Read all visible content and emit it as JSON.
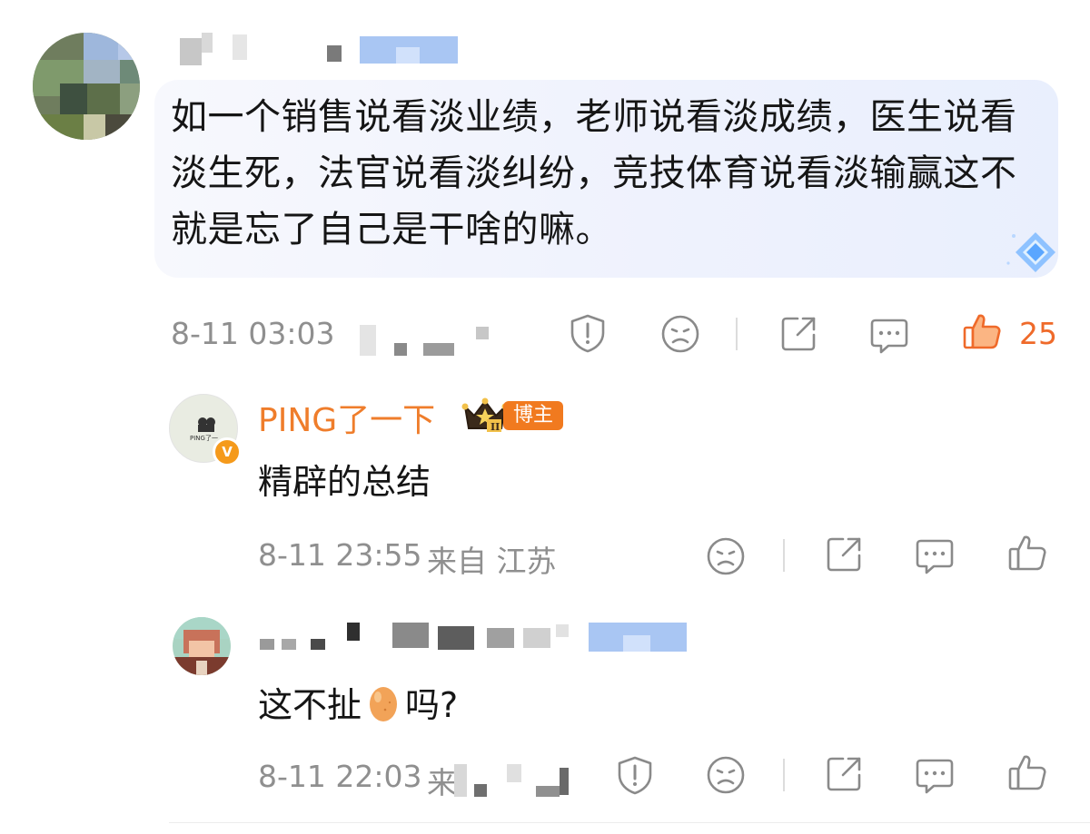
{
  "comment": {
    "text": "如一个销售说看淡业绩，老师说看淡成绩，医生说看淡生死，法官说看淡纠纷，竞技体育说看淡输赢这不就是忘了自己是干啥的嘛。",
    "time": "8-11 03:03",
    "like_count": "25",
    "accent_color": "#ef6a2a"
  },
  "replies": [
    {
      "username": "PING了一下",
      "role_badge": "博主",
      "avatar_text": "PING了一",
      "verified_badge": "V",
      "text": "精辟的总结",
      "time": "8-11 23:55",
      "location": "来自 江苏",
      "name_color": "#ef7d2b"
    },
    {
      "text_before": "这不扯",
      "text_after": "吗?",
      "emoji": "egg",
      "time": "8-11 22:03",
      "location_partial": "来"
    }
  ],
  "icons": [
    "report-icon",
    "dislike-icon",
    "share-icon",
    "comment-icon",
    "like-icon",
    "crown-icon",
    "diamond-icon",
    "egg-emoji-icon"
  ]
}
